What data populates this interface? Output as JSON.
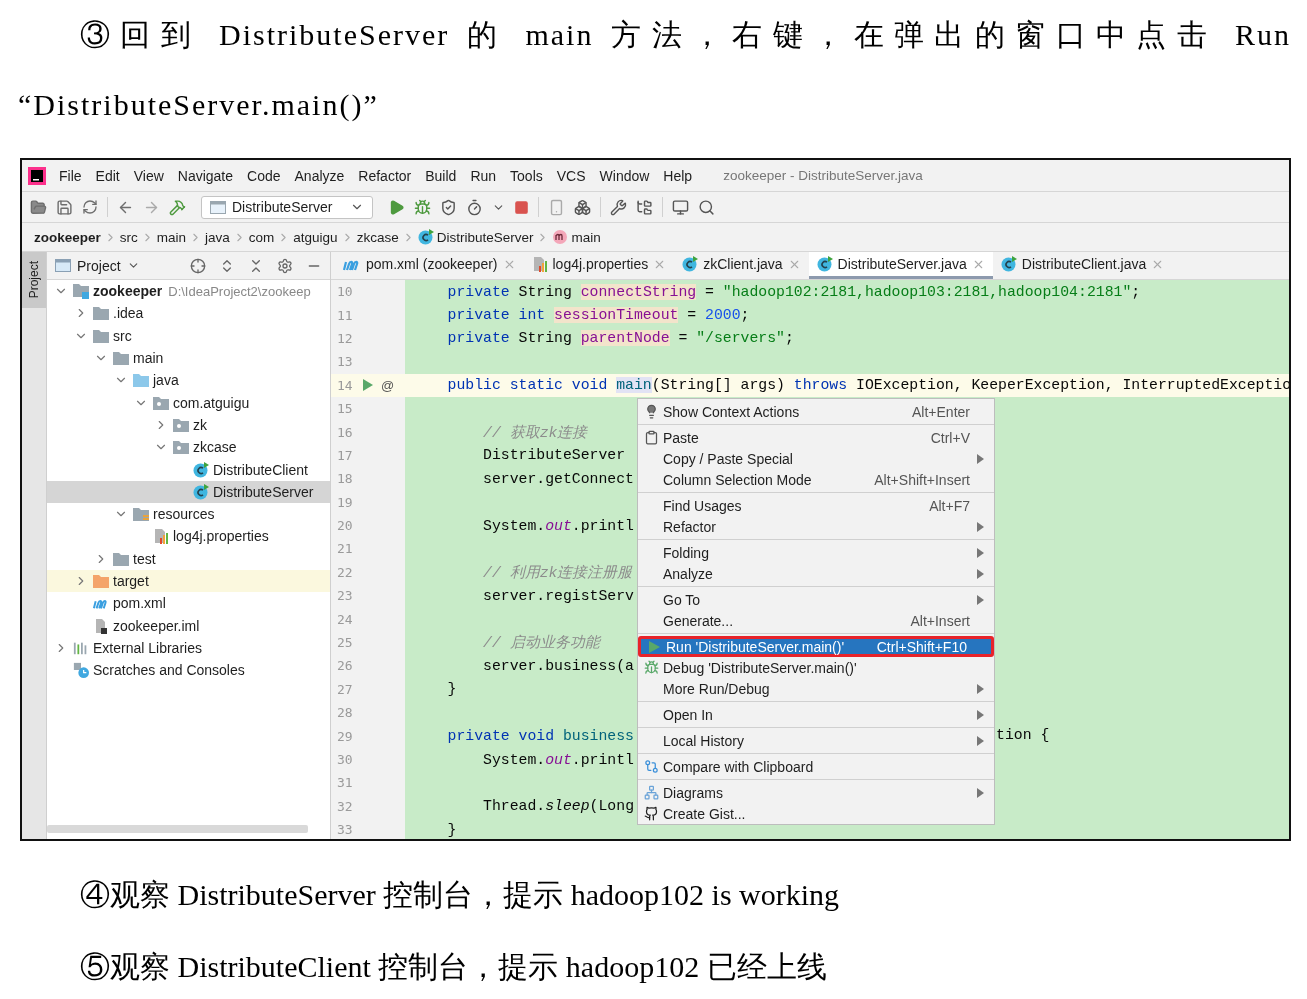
{
  "instruction": "③回到 DistributeServer 的 main 方法，右键，在弹出的窗口中点击 Run “DistributeServer.main()”",
  "ide": {
    "menu": [
      "File",
      "Edit",
      "View",
      "Navigate",
      "Code",
      "Analyze",
      "Refactor",
      "Build",
      "Run",
      "Tools",
      "VCS",
      "Window",
      "Help"
    ],
    "title": "zookeeper - DistributeServer.java",
    "run_config": "DistributeServer",
    "breadcrumbs": [
      {
        "label": "zookeeper",
        "kind": "root"
      },
      {
        "label": "src",
        "kind": "folder"
      },
      {
        "label": "main",
        "kind": "folder"
      },
      {
        "label": "java",
        "kind": "folder"
      },
      {
        "label": "com",
        "kind": "folder"
      },
      {
        "label": "atguigu",
        "kind": "folder"
      },
      {
        "label": "zkcase",
        "kind": "folder"
      },
      {
        "label": "DistributeServer",
        "kind": "class"
      },
      {
        "label": "main",
        "kind": "method"
      }
    ],
    "side_tab": "Project",
    "project": {
      "title": "Project",
      "tree": [
        {
          "label": "zookeeper",
          "kind": "module",
          "path": "D:\\IdeaProject2\\zookeep",
          "expanded": true,
          "selected": false,
          "children": [
            {
              "label": ".idea",
              "kind": "folder",
              "expanded": false,
              "selected": false
            },
            {
              "label": "src",
              "kind": "folder",
              "expanded": true,
              "selected": false,
              "children": [
                {
                  "label": "main",
                  "kind": "folder",
                  "expanded": true,
                  "selected": false,
                  "children": [
                    {
                      "label": "java",
                      "kind": "source-folder",
                      "expanded": true,
                      "selected": false,
                      "children": [
                        {
                          "label": "com.atguigu",
                          "kind": "package",
                          "expanded": true,
                          "selected": false,
                          "children": [
                            {
                              "label": "zk",
                              "kind": "package",
                              "expanded": false,
                              "selected": false
                            },
                            {
                              "label": "zkcase",
                              "kind": "package",
                              "expanded": true,
                              "selected": false,
                              "children": [
                                {
                                  "label": "DistributeClient",
                                  "kind": "class",
                                  "selected": false
                                },
                                {
                                  "label": "DistributeServer",
                                  "kind": "class",
                                  "selected": true
                                }
                              ]
                            }
                          ]
                        }
                      ]
                    },
                    {
                      "label": "resources",
                      "kind": "resources-folder",
                      "expanded": true,
                      "selected": false,
                      "children": [
                        {
                          "label": "log4j.properties",
                          "kind": "properties",
                          "selected": false
                        }
                      ]
                    }
                  ]
                },
                {
                  "label": "test",
                  "kind": "folder",
                  "expanded": false,
                  "selected": false
                }
              ]
            },
            {
              "label": "target",
              "kind": "excluded-folder",
              "expanded": false,
              "selected": false
            },
            {
              "label": "pom.xml",
              "kind": "maven",
              "selected": false
            },
            {
              "label": "zookeeper.iml",
              "kind": "iml",
              "selected": false
            }
          ]
        },
        {
          "label": "External Libraries",
          "kind": "libraries",
          "expanded": false,
          "selected": false
        },
        {
          "label": "Scratches and Consoles",
          "kind": "scratches",
          "selected": false
        }
      ]
    },
    "tabs": [
      {
        "label": "pom.xml (zookeeper)",
        "kind": "maven",
        "selected": false
      },
      {
        "label": "log4j.properties",
        "kind": "properties",
        "selected": false
      },
      {
        "label": "zkClient.java",
        "kind": "class",
        "selected": false
      },
      {
        "label": "DistributeServer.java",
        "kind": "class",
        "selected": true
      },
      {
        "label": "DistributeClient.java",
        "kind": "class",
        "selected": false
      }
    ],
    "code": [
      {
        "n": "10",
        "current": false,
        "tokens": [
          {
            "text": "    private",
            "kind": "kw"
          },
          {
            "text": " String ",
            "kind": "plain"
          },
          {
            "text": "connectString",
            "kind": "field"
          },
          {
            "text": " = ",
            "kind": "plain"
          },
          {
            "text": "\"hadoop102:2181,hadoop103:2181,hadoop104:2181\"",
            "kind": "string"
          },
          {
            "text": ";",
            "kind": "plain"
          }
        ]
      },
      {
        "n": "11",
        "current": false,
        "tokens": [
          {
            "text": "    private int ",
            "kind": "kw"
          },
          {
            "text": "sessionTimeout",
            "kind": "field"
          },
          {
            "text": " = ",
            "kind": "plain"
          },
          {
            "text": "2000",
            "kind": "number"
          },
          {
            "text": ";",
            "kind": "plain"
          }
        ]
      },
      {
        "n": "12",
        "current": false,
        "tokens": [
          {
            "text": "    private",
            "kind": "kw"
          },
          {
            "text": " String ",
            "kind": "plain"
          },
          {
            "text": "parentNode",
            "kind": "field"
          },
          {
            "text": " = ",
            "kind": "plain"
          },
          {
            "text": "\"/servers\"",
            "kind": "string"
          },
          {
            "text": ";",
            "kind": "plain"
          }
        ]
      },
      {
        "n": "13",
        "current": false
      },
      {
        "n": "14",
        "current": true,
        "run": true,
        "marker": "@",
        "tokens": [
          {
            "text": "    public static void ",
            "kind": "kw"
          },
          {
            "text": "main",
            "kind": "decl"
          },
          {
            "text": "(String[] args) ",
            "kind": "plain"
          },
          {
            "text": "throws",
            "kind": "kw"
          },
          {
            "text": " IOException, KeeperException, InterruptedExceptio",
            "kind": "plain"
          }
        ]
      },
      {
        "n": "15",
        "current": false
      },
      {
        "n": "16",
        "current": false,
        "tokens": [
          {
            "text": "        // 获取zk连接",
            "kind": "comment"
          }
        ]
      },
      {
        "n": "17",
        "current": false,
        "tokens": [
          {
            "text": "        DistributeServer",
            "kind": "plain"
          }
        ]
      },
      {
        "n": "18",
        "current": false,
        "tokens": [
          {
            "text": "        server.getConnect",
            "kind": "plain"
          }
        ]
      },
      {
        "n": "19",
        "current": false
      },
      {
        "n": "20",
        "current": false,
        "tokens": [
          {
            "text": "        System.",
            "kind": "plain"
          },
          {
            "text": "out",
            "kind": "static"
          },
          {
            "text": ".printl",
            "kind": "plain"
          }
        ]
      },
      {
        "n": "21",
        "current": false
      },
      {
        "n": "22",
        "current": false,
        "tokens": [
          {
            "text": "        // 利用zk连接注册服",
            "kind": "comment"
          }
        ]
      },
      {
        "n": "23",
        "current": false,
        "tokens": [
          {
            "text": "        server.registServ",
            "kind": "plain"
          }
        ]
      },
      {
        "n": "24",
        "current": false
      },
      {
        "n": "25",
        "current": false,
        "tokens": [
          {
            "text": "        // 启动业务功能",
            "kind": "comment"
          }
        ]
      },
      {
        "n": "26",
        "current": false,
        "tokens": [
          {
            "text": "        server.business(a",
            "kind": "plain"
          }
        ]
      },
      {
        "n": "27",
        "current": false,
        "tokens": [
          {
            "text": "    }",
            "kind": "plain"
          }
        ]
      },
      {
        "n": "28",
        "current": false
      },
      {
        "n": "29",
        "current": false,
        "tail": "tion {",
        "tokens": [
          {
            "text": "    private void ",
            "kind": "kw"
          },
          {
            "text": "business",
            "kind": "method"
          }
        ]
      },
      {
        "n": "30",
        "current": false,
        "tokens": [
          {
            "text": "        System.",
            "kind": "plain"
          },
          {
            "text": "out",
            "kind": "static"
          },
          {
            "text": ".printl",
            "kind": "plain"
          }
        ]
      },
      {
        "n": "31",
        "current": false
      },
      {
        "n": "32",
        "current": false,
        "tokens": [
          {
            "text": "        Thread.",
            "kind": "plain"
          },
          {
            "text": "sleep",
            "kind": "italic"
          },
          {
            "text": "(Long",
            "kind": "plain"
          }
        ]
      },
      {
        "n": "33",
        "current": false,
        "tokens": [
          {
            "text": "    }",
            "kind": "plain"
          }
        ]
      }
    ],
    "context_menu": [
      {
        "label": "Show Context Actions",
        "shortcut": "Alt+Enter",
        "kind": "context-actions",
        "submenu": false,
        "separator_after": true,
        "selected": false
      },
      {
        "label": "Paste",
        "shortcut": "Ctrl+V",
        "kind": "paste",
        "submenu": false,
        "separator_after": false,
        "selected": false
      },
      {
        "label": "Copy / Paste Special",
        "kind": "plain",
        "submenu": true,
        "separator_after": false,
        "selected": false
      },
      {
        "label": "Column Selection Mode",
        "shortcut": "Alt+Shift+Insert",
        "kind": "plain",
        "submenu": false,
        "separator_after": true,
        "selected": false
      },
      {
        "label": "Find Usages",
        "shortcut": "Alt+F7",
        "kind": "plain",
        "submenu": false,
        "separator_after": false,
        "selected": false
      },
      {
        "label": "Refactor",
        "kind": "plain",
        "submenu": true,
        "separator_after": true,
        "selected": false
      },
      {
        "label": "Folding",
        "kind": "plain",
        "submenu": true,
        "separator_after": false,
        "selected": false
      },
      {
        "label": "Analyze",
        "kind": "plain",
        "submenu": true,
        "separator_after": true,
        "selected": false
      },
      {
        "label": "Go To",
        "kind": "plain",
        "submenu": true,
        "separator_after": false,
        "selected": false
      },
      {
        "label": "Generate...",
        "shortcut": "Alt+Insert",
        "kind": "plain",
        "submenu": false,
        "separator_after": true,
        "selected": false
      },
      {
        "label": "Run 'DistributeServer.main()'",
        "shortcut": "Ctrl+Shift+F10",
        "kind": "run",
        "submenu": false,
        "separator_after": false,
        "selected": true
      },
      {
        "label": "Debug 'DistributeServer.main()'",
        "kind": "debug",
        "submenu": false,
        "separator_after": false,
        "selected": false
      },
      {
        "label": "More Run/Debug",
        "kind": "plain",
        "submenu": true,
        "separator_after": true,
        "selected": false
      },
      {
        "label": "Open In",
        "kind": "plain",
        "submenu": true,
        "separator_after": true,
        "selected": false
      },
      {
        "label": "Local History",
        "kind": "plain",
        "submenu": true,
        "separator_after": true,
        "selected": false
      },
      {
        "label": "Compare with Clipboard",
        "kind": "compare",
        "submenu": false,
        "separator_after": true,
        "selected": false
      },
      {
        "label": "Diagrams",
        "kind": "diagrams",
        "submenu": true,
        "separator_after": false,
        "selected": false
      },
      {
        "label": "Create Gist...",
        "kind": "gist",
        "submenu": false,
        "separator_after": false,
        "selected": false
      }
    ]
  },
  "steps": [
    "④观察 DistributeServer 控制台，提示 hadoop102 is working",
    "⑤观察 DistributeClient 控制台，提示 hadoop102 已经上线"
  ]
}
